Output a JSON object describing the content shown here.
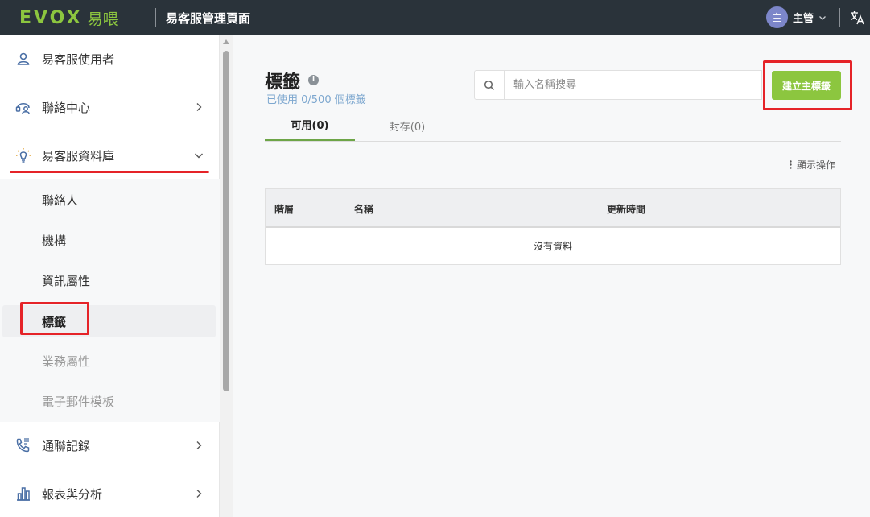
{
  "header": {
    "logo_text": "EVOX",
    "logo_cn": "易喂",
    "title": "易客服管理頁面",
    "user": {
      "avatar_initial": "主",
      "name": "主管"
    },
    "icons": {
      "user_menu": "chevron-down-icon",
      "language": "translate-icon"
    }
  },
  "sidebar": {
    "items": [
      {
        "label": "易客服使用者",
        "icon": "user-icon"
      },
      {
        "label": "聯絡中心",
        "icon": "headset-icon",
        "chevron": "chevron-right-icon"
      },
      {
        "label": "易客服資料庫",
        "icon": "lightbulb-icon",
        "chevron": "chevron-down-icon",
        "expanded": true
      },
      {
        "label": "通聯記錄",
        "icon": "phone-log-icon",
        "chevron": "chevron-right-icon"
      },
      {
        "label": "報表與分析",
        "icon": "bar-chart-icon",
        "chevron": "chevron-right-icon"
      }
    ],
    "subitems": [
      {
        "label": "聯絡人"
      },
      {
        "label": "機構"
      },
      {
        "label": "資訊屬性"
      },
      {
        "label": "標籤",
        "active": true
      },
      {
        "label": "業務屬性",
        "disabled": true
      },
      {
        "label": "電子郵件模板",
        "disabled": true
      }
    ]
  },
  "main": {
    "title": "標籤",
    "info_icon": "i",
    "usage": "已使用 0/500 個標籤",
    "search": {
      "placeholder": "輸入名稱搜尋",
      "value": ""
    },
    "create_button": "建立主標籤",
    "tabs": [
      {
        "label": "可用(0)",
        "active": true
      },
      {
        "label": "封存(0)",
        "active": false
      }
    ],
    "actions_label": "顯示操作",
    "table": {
      "columns": [
        "階層",
        "名稱",
        "更新時間"
      ],
      "empty_text": "沒有資料"
    }
  },
  "colors": {
    "header_bg": "#2a333a",
    "brand_green": "#8cc63f",
    "tab_underline": "#6da547",
    "annotation_red": "#e52328",
    "avatar_bg": "#7c86c9"
  }
}
